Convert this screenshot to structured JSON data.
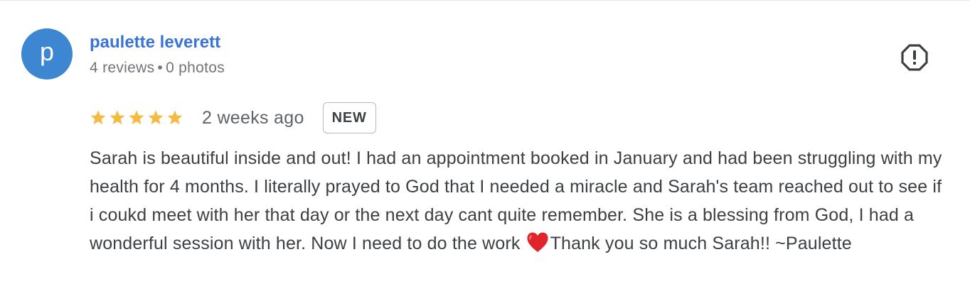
{
  "review": {
    "reviewer": {
      "avatar_letter": "p",
      "avatar_color": "#3d86d2",
      "name": "paulette leverett",
      "reviews_count": "4 reviews",
      "separator": "•",
      "photos_count": "0 photos"
    },
    "rating": {
      "stars": 5,
      "max_stars": 5,
      "star_color": "#f6bb42"
    },
    "date": "2 weeks ago",
    "badge": "NEW",
    "text_before_heart": "Sarah is beautiful inside and out! I had an appointment booked in January and had been struggling with my health for 4 months. I literally prayed to God that I needed a miracle and Sarah's team reached out to see if i coukd meet with her that day or the next day cant quite remember. She is a blessing from God, I had a wonderful session with her. Now I need to do the work ",
    "heart_icon": "red-heart-icon",
    "text_after_heart": "Thank you so much Sarah!! ~Paulette",
    "flag_icon": "report-flag-icon"
  }
}
